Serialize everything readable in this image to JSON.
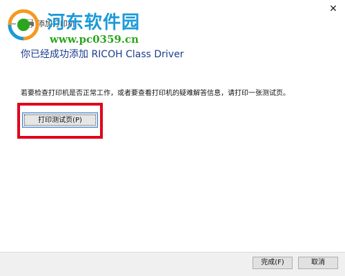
{
  "window": {
    "title": "添加打印机",
    "close_glyph": "✕",
    "back_glyph": "←"
  },
  "watermark": {
    "site_name": "河东软件园",
    "url": "www.pc0359.cn"
  },
  "main": {
    "headline": "你已经成功添加 RICOH Class Driver",
    "info": "若要检查打印机是否正常工作，或者要查看打印机的疑难解答信息，请打印一张测试页。",
    "print_test_label": "打印测试页(P)"
  },
  "footer": {
    "finish_label": "完成(F)",
    "cancel_label": "取消"
  },
  "colors": {
    "headline": "#1a3c8c",
    "highlight": "#e0001a",
    "watermark_name": "#1b9ad8",
    "watermark_url": "#2aa61e",
    "footer_bg": "#f0f0f0"
  },
  "icons": [
    "close-icon",
    "back-arrow-icon",
    "printer-icon",
    "watermark-logo-icon"
  ]
}
